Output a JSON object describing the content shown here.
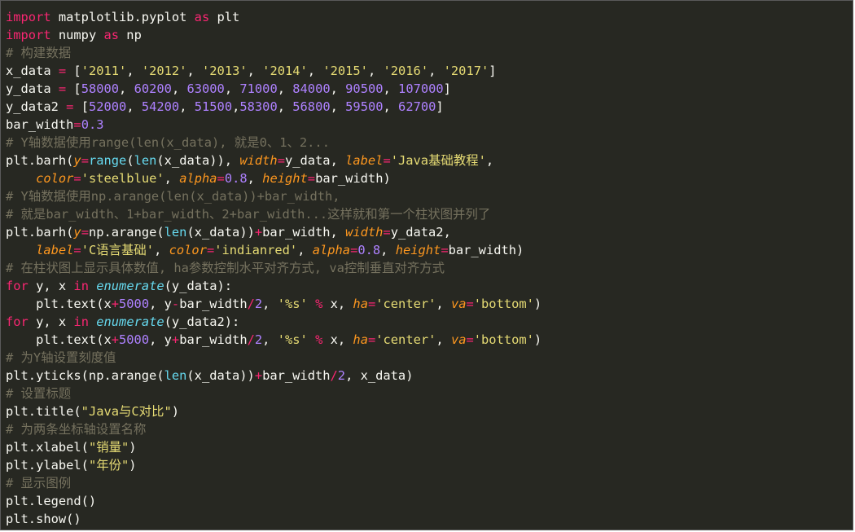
{
  "editor": {
    "theme": {
      "background": "#272822",
      "text": "#f8f8f2",
      "keyword": "#f92672",
      "number": "#ae81ff",
      "string": "#e6db74",
      "comment": "#75715e",
      "builtin": "#66d9ef",
      "argument": "#fd971f"
    },
    "lines": [
      [
        [
          "kw",
          "import"
        ],
        [
          "id",
          " matplotlib.pyplot "
        ],
        [
          "kw",
          "as"
        ],
        [
          "id",
          " plt"
        ]
      ],
      [
        [
          "kw",
          "import"
        ],
        [
          "id",
          " numpy "
        ],
        [
          "kw",
          "as"
        ],
        [
          "id",
          " np"
        ]
      ],
      [
        [
          "cm",
          "# 构建数据"
        ]
      ],
      [
        [
          "id",
          "x_data "
        ],
        [
          "op",
          "="
        ],
        [
          "id",
          " ["
        ],
        [
          "str",
          "'2011'"
        ],
        [
          "id",
          ", "
        ],
        [
          "str",
          "'2012'"
        ],
        [
          "id",
          ", "
        ],
        [
          "str",
          "'2013'"
        ],
        [
          "id",
          ", "
        ],
        [
          "str",
          "'2014'"
        ],
        [
          "id",
          ", "
        ],
        [
          "str",
          "'2015'"
        ],
        [
          "id",
          ", "
        ],
        [
          "str",
          "'2016'"
        ],
        [
          "id",
          ", "
        ],
        [
          "str",
          "'2017'"
        ],
        [
          "id",
          "]"
        ]
      ],
      [
        [
          "id",
          "y_data "
        ],
        [
          "op",
          "="
        ],
        [
          "id",
          " ["
        ],
        [
          "num",
          "58000"
        ],
        [
          "id",
          ", "
        ],
        [
          "num",
          "60200"
        ],
        [
          "id",
          ", "
        ],
        [
          "num",
          "63000"
        ],
        [
          "id",
          ", "
        ],
        [
          "num",
          "71000"
        ],
        [
          "id",
          ", "
        ],
        [
          "num",
          "84000"
        ],
        [
          "id",
          ", "
        ],
        [
          "num",
          "90500"
        ],
        [
          "id",
          ", "
        ],
        [
          "num",
          "107000"
        ],
        [
          "id",
          "]"
        ]
      ],
      [
        [
          "id",
          "y_data2 "
        ],
        [
          "op",
          "="
        ],
        [
          "id",
          " ["
        ],
        [
          "num",
          "52000"
        ],
        [
          "id",
          ", "
        ],
        [
          "num",
          "54200"
        ],
        [
          "id",
          ", "
        ],
        [
          "num",
          "51500"
        ],
        [
          "id",
          ","
        ],
        [
          "num",
          "58300"
        ],
        [
          "id",
          ", "
        ],
        [
          "num",
          "56800"
        ],
        [
          "id",
          ", "
        ],
        [
          "num",
          "59500"
        ],
        [
          "id",
          ", "
        ],
        [
          "num",
          "62700"
        ],
        [
          "id",
          "]"
        ]
      ],
      [
        [
          "id",
          "bar_width"
        ],
        [
          "op",
          "="
        ],
        [
          "num",
          "0.3"
        ]
      ],
      [
        [
          "cm",
          "# Y轴数据使用range(len(x_data), 就是0、1、2..."
        ]
      ],
      [
        [
          "id",
          "plt.barh("
        ],
        [
          "arg",
          "y"
        ],
        [
          "op",
          "="
        ],
        [
          "bi",
          "range"
        ],
        [
          "id",
          "("
        ],
        [
          "bi",
          "len"
        ],
        [
          "id",
          "(x_data)), "
        ],
        [
          "arg",
          "width"
        ],
        [
          "op",
          "="
        ],
        [
          "id",
          "y_data, "
        ],
        [
          "arg",
          "label"
        ],
        [
          "op",
          "="
        ],
        [
          "str",
          "'Java基础教程'"
        ],
        [
          "id",
          ","
        ]
      ],
      [
        [
          "id",
          "    "
        ],
        [
          "arg",
          "color"
        ],
        [
          "op",
          "="
        ],
        [
          "str",
          "'steelblue'"
        ],
        [
          "id",
          ", "
        ],
        [
          "arg",
          "alpha"
        ],
        [
          "op",
          "="
        ],
        [
          "num",
          "0.8"
        ],
        [
          "id",
          ", "
        ],
        [
          "arg",
          "height"
        ],
        [
          "op",
          "="
        ],
        [
          "id",
          "bar_width)"
        ]
      ],
      [
        [
          "cm",
          "# Y轴数据使用np.arange(len(x_data))+bar_width,"
        ]
      ],
      [
        [
          "cm",
          "# 就是bar_width、1+bar_width、2+bar_width...这样就和第一个柱状图并列了"
        ]
      ],
      [
        [
          "id",
          "plt.barh("
        ],
        [
          "arg",
          "y"
        ],
        [
          "op",
          "="
        ],
        [
          "id",
          "np.arange("
        ],
        [
          "bi",
          "len"
        ],
        [
          "id",
          "(x_data))"
        ],
        [
          "op",
          "+"
        ],
        [
          "id",
          "bar_width, "
        ],
        [
          "arg",
          "width"
        ],
        [
          "op",
          "="
        ],
        [
          "id",
          "y_data2,"
        ]
      ],
      [
        [
          "id",
          "    "
        ],
        [
          "arg",
          "label"
        ],
        [
          "op",
          "="
        ],
        [
          "str",
          "'C语言基础'"
        ],
        [
          "id",
          ", "
        ],
        [
          "arg",
          "color"
        ],
        [
          "op",
          "="
        ],
        [
          "str",
          "'indianred'"
        ],
        [
          "id",
          ", "
        ],
        [
          "arg",
          "alpha"
        ],
        [
          "op",
          "="
        ],
        [
          "num",
          "0.8"
        ],
        [
          "id",
          ", "
        ],
        [
          "arg",
          "height"
        ],
        [
          "op",
          "="
        ],
        [
          "id",
          "bar_width)"
        ]
      ],
      [
        [
          "cm",
          "# 在柱状图上显示具体数值, ha参数控制水平对齐方式, va控制垂直对齐方式"
        ]
      ],
      [
        [
          "kw",
          "for"
        ],
        [
          "id",
          " y, x "
        ],
        [
          "kw",
          "in"
        ],
        [
          "id",
          " "
        ],
        [
          "fn",
          "enumerate"
        ],
        [
          "id",
          "(y_data):"
        ]
      ],
      [
        [
          "id",
          "    plt.text(x"
        ],
        [
          "op",
          "+"
        ],
        [
          "num",
          "5000"
        ],
        [
          "id",
          ", y"
        ],
        [
          "op",
          "-"
        ],
        [
          "id",
          "bar_width"
        ],
        [
          "op",
          "/"
        ],
        [
          "num",
          "2"
        ],
        [
          "id",
          ", "
        ],
        [
          "str",
          "'%s'"
        ],
        [
          "id",
          " "
        ],
        [
          "op",
          "%"
        ],
        [
          "id",
          " x, "
        ],
        [
          "arg",
          "ha"
        ],
        [
          "op",
          "="
        ],
        [
          "str",
          "'center'"
        ],
        [
          "id",
          ", "
        ],
        [
          "arg",
          "va"
        ],
        [
          "op",
          "="
        ],
        [
          "str",
          "'bottom'"
        ],
        [
          "id",
          ")"
        ]
      ],
      [
        [
          "kw",
          "for"
        ],
        [
          "id",
          " y, x "
        ],
        [
          "kw",
          "in"
        ],
        [
          "id",
          " "
        ],
        [
          "fn",
          "enumerate"
        ],
        [
          "id",
          "(y_data2):"
        ]
      ],
      [
        [
          "id",
          "    plt.text(x"
        ],
        [
          "op",
          "+"
        ],
        [
          "num",
          "5000"
        ],
        [
          "id",
          ", y"
        ],
        [
          "op",
          "+"
        ],
        [
          "id",
          "bar_width"
        ],
        [
          "op",
          "/"
        ],
        [
          "num",
          "2"
        ],
        [
          "id",
          ", "
        ],
        [
          "str",
          "'%s'"
        ],
        [
          "id",
          " "
        ],
        [
          "op",
          "%"
        ],
        [
          "id",
          " x, "
        ],
        [
          "arg",
          "ha"
        ],
        [
          "op",
          "="
        ],
        [
          "str",
          "'center'"
        ],
        [
          "id",
          ", "
        ],
        [
          "arg",
          "va"
        ],
        [
          "op",
          "="
        ],
        [
          "str",
          "'bottom'"
        ],
        [
          "id",
          ")"
        ]
      ],
      [
        [
          "cm",
          "# 为Y轴设置刻度值"
        ]
      ],
      [
        [
          "id",
          "plt.yticks(np.arange("
        ],
        [
          "bi",
          "len"
        ],
        [
          "id",
          "(x_data))"
        ],
        [
          "op",
          "+"
        ],
        [
          "id",
          "bar_width"
        ],
        [
          "op",
          "/"
        ],
        [
          "num",
          "2"
        ],
        [
          "id",
          ", x_data)"
        ]
      ],
      [
        [
          "cm",
          "# 设置标题"
        ]
      ],
      [
        [
          "id",
          "plt.title("
        ],
        [
          "str",
          "\"Java与C对比\""
        ],
        [
          "id",
          ")"
        ]
      ],
      [
        [
          "cm",
          "# 为两条坐标轴设置名称"
        ]
      ],
      [
        [
          "id",
          "plt.xlabel("
        ],
        [
          "str",
          "\"销量\""
        ],
        [
          "id",
          ")"
        ]
      ],
      [
        [
          "id",
          "plt.ylabel("
        ],
        [
          "str",
          "\"年份\""
        ],
        [
          "id",
          ")"
        ]
      ],
      [
        [
          "cm",
          "# 显示图例"
        ]
      ],
      [
        [
          "id",
          "plt.legend()"
        ]
      ],
      [
        [
          "id",
          "plt.show()"
        ]
      ]
    ]
  }
}
